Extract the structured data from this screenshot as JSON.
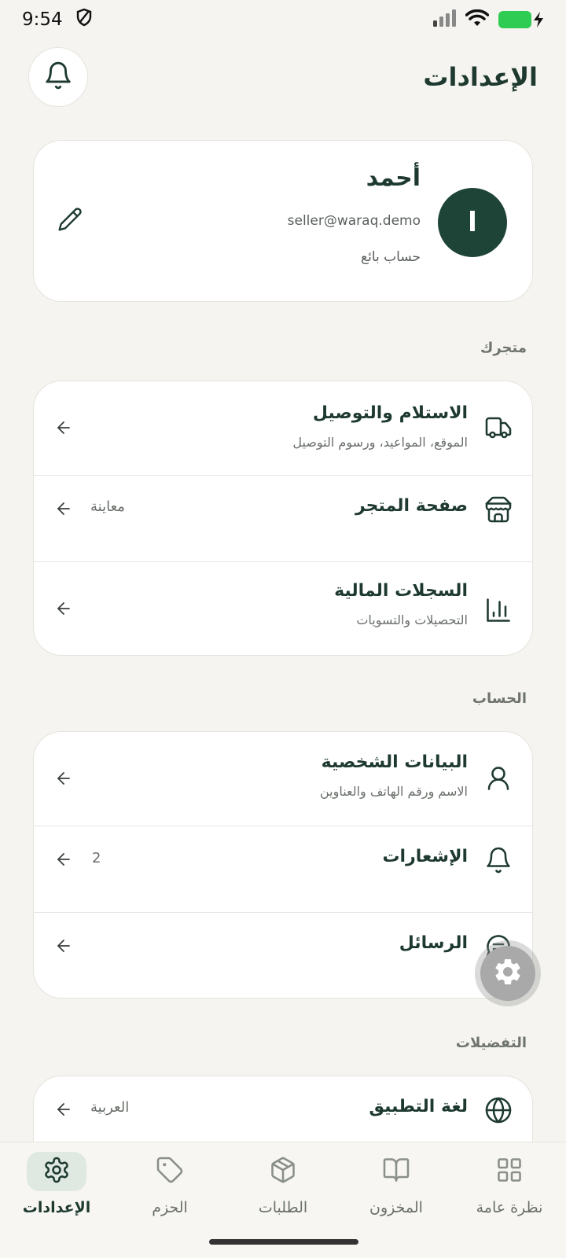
{
  "status_bar": {
    "time": "9:54"
  },
  "header": {
    "title": "الإعدادات"
  },
  "profile": {
    "initial": "ا",
    "name": "أحمد",
    "email": "seller@waraq.demo",
    "role": "حساب بائع"
  },
  "sections": {
    "store": {
      "label": "متجرك",
      "items": [
        {
          "title": "الاستلام والتوصيل",
          "subtitle": "الموقع، المواعيد، ورسوم التوصيل",
          "icon": "truck-icon"
        },
        {
          "title": "صفحة المتجر",
          "value": "معاينة",
          "icon": "store-icon"
        },
        {
          "title": "السجلات المالية",
          "subtitle": "التحصيلات والتسويات",
          "icon": "chart-icon"
        }
      ]
    },
    "account": {
      "label": "الحساب",
      "items": [
        {
          "title": "البيانات الشخصية",
          "subtitle": "الاسم ورقم الهاتف والعناوين",
          "icon": "user-icon"
        },
        {
          "title": "الإشعارات",
          "value": "2",
          "icon": "bell-icon"
        },
        {
          "title": "الرسائل",
          "icon": "chat-icon"
        }
      ]
    },
    "preferences": {
      "label": "التفضيلات",
      "items": [
        {
          "title": "لغة التطبيق",
          "value": "العربية",
          "icon": "globe-icon"
        }
      ]
    }
  },
  "bottom_nav": [
    {
      "label": "الإعدادات",
      "icon": "gear-icon",
      "active": true
    },
    {
      "label": "الحزم",
      "icon": "tag-icon",
      "active": false
    },
    {
      "label": "الطلبات",
      "icon": "box-icon",
      "active": false
    },
    {
      "label": "المخزون",
      "icon": "book-icon",
      "active": false
    },
    {
      "label": "نظرة عامة",
      "icon": "grid-icon",
      "active": false
    }
  ],
  "colors": {
    "primary": "#1d4437",
    "background": "#f5f4f0",
    "card": "#ffffff",
    "muted": "#6a6f6a"
  }
}
